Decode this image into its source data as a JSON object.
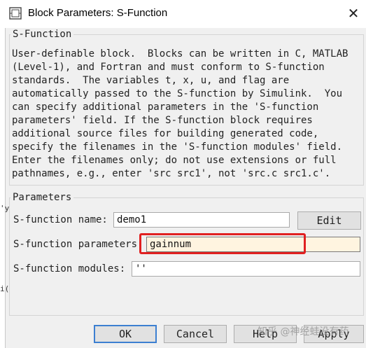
{
  "window": {
    "title": "Block Parameters: S-Function",
    "icon": "simulink-block-icon",
    "close_symbol": "✕"
  },
  "sfunction_group": {
    "legend": "S-Function",
    "description": [
      "User-definable block.  Blocks can be written in C, MATLAB",
      "(Level-1), and Fortran and must conform to S-function",
      "standards.  The variables t, x, u, and flag are",
      "automatically passed to the S-function by Simulink.  You",
      "can specify additional parameters in the 'S-function",
      "parameters' field. If the S-function block requires",
      "additional source files for building generated code,",
      "specify the filenames in the 'S-function modules' field.",
      "Enter the filenames only; do not use extensions or full",
      "pathnames, e.g., enter 'src src1', not 'src.c src1.c'."
    ]
  },
  "parameters_group": {
    "legend": "Parameters",
    "name_label": "S-function name:",
    "name_value": "demo1",
    "edit_label": "Edit",
    "params_label": "S-function parameters",
    "params_value": "gainnum",
    "modules_label": "S-function modules:",
    "modules_value": "''"
  },
  "buttons": {
    "ok": "OK",
    "cancel": "Cancel",
    "help": "Help",
    "apply": "Apply"
  },
  "left_strip": [
    "'y",
    "i("
  ],
  "watermark": "知乎 @神经蛙没有药",
  "colors": {
    "highlight": "#e02020",
    "primary_button_border": "#3c7fd1",
    "active_field_bg": "#fff4e0"
  }
}
